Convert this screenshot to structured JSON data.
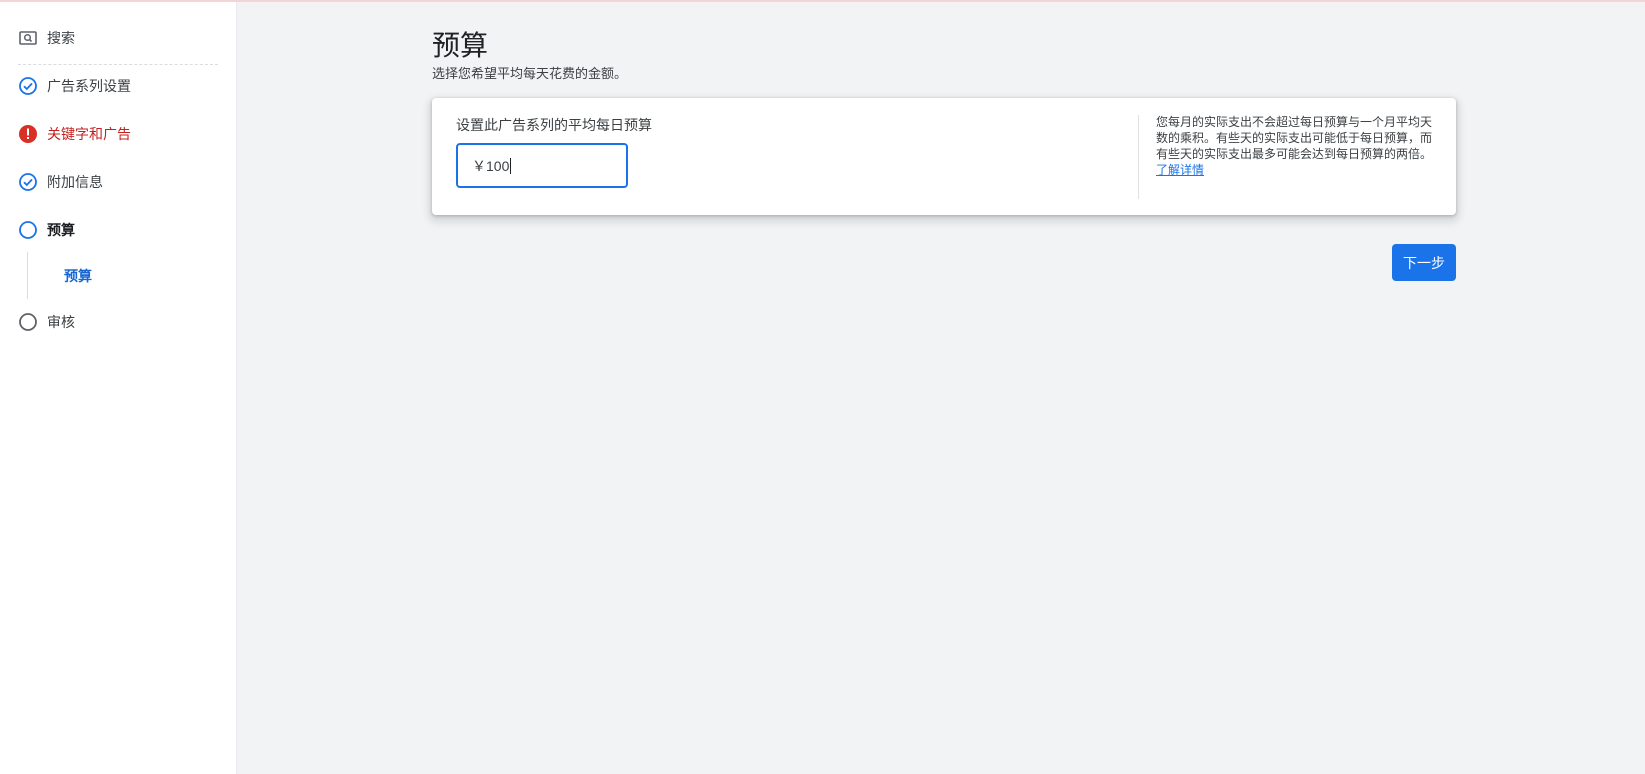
{
  "sidebar": {
    "search": {
      "label": "搜索",
      "icon": "search-icon"
    },
    "steps": [
      {
        "label": "广告系列设置",
        "status": "complete",
        "icon": "check-circle-icon"
      },
      {
        "label": "关键字和广告",
        "status": "error",
        "icon": "error-circle-icon"
      },
      {
        "label": "附加信息",
        "status": "complete",
        "icon": "check-circle-icon"
      },
      {
        "label": "预算",
        "status": "current",
        "icon": "empty-circle-icon"
      },
      {
        "label": "审核",
        "status": "pending",
        "icon": "empty-circle-icon"
      }
    ],
    "sub_step": {
      "label": "预算"
    }
  },
  "main": {
    "title": "预算",
    "subtitle": "选择您希望平均每天花费的金额。",
    "budget_card": {
      "field_label": "设置此广告系列的平均每日预算",
      "input_value": "￥100",
      "help_text": "您每月的实际支出不会超过每日预算与一个月平均天数的乘积。有些天的实际支出可能低于每日预算，而有些天的实际支出最多可能会达到每日预算的两倍。",
      "help_link": "了解详情"
    },
    "next_button": "下一步"
  },
  "colors": {
    "accent": "#1a73e8",
    "error": "#d93025",
    "background": "#f1f3f4"
  }
}
